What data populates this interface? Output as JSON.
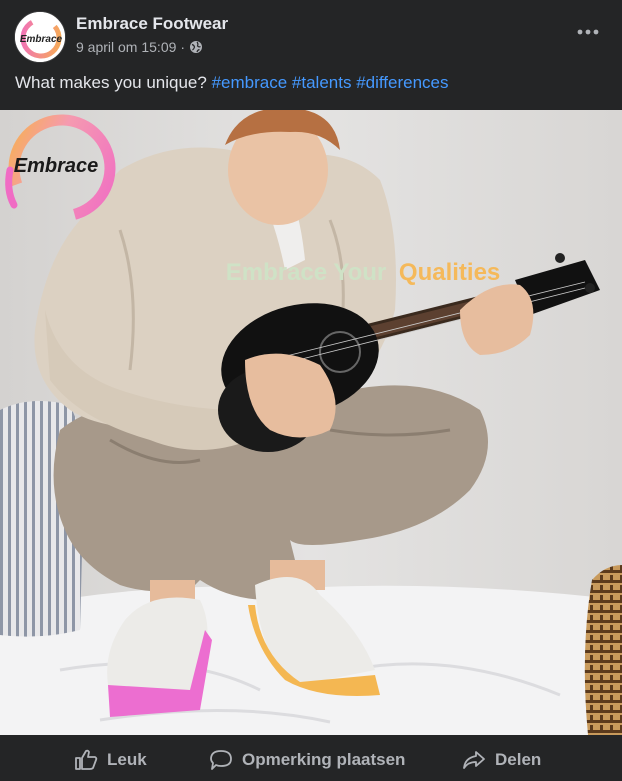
{
  "post": {
    "page_name": "Embrace Footwear",
    "timestamp": "9 april om 15:09",
    "separator": "·",
    "privacy_icon": "globe-icon",
    "more_icon": "more-horizontal-icon",
    "caption_text": "What makes you unique?",
    "hashtags": [
      "#embrace",
      "#talents",
      "#differences"
    ]
  },
  "avatar": {
    "logo_text": "Embrace"
  },
  "image": {
    "logo_text": "Embrace",
    "overlay_part1": "Embrace Your",
    "overlay_part2": "Qualities"
  },
  "actions": {
    "like_label": "Leuk",
    "comment_label": "Opmerking plaatsen",
    "share_label": "Delen"
  },
  "colors": {
    "background": "#242526",
    "text": "#e4e6eb",
    "secondary_text": "#b0b3b8",
    "hashtag": "#4599ff",
    "brand_pink": "#f06cc4",
    "brand_orange": "#f7b24a"
  }
}
